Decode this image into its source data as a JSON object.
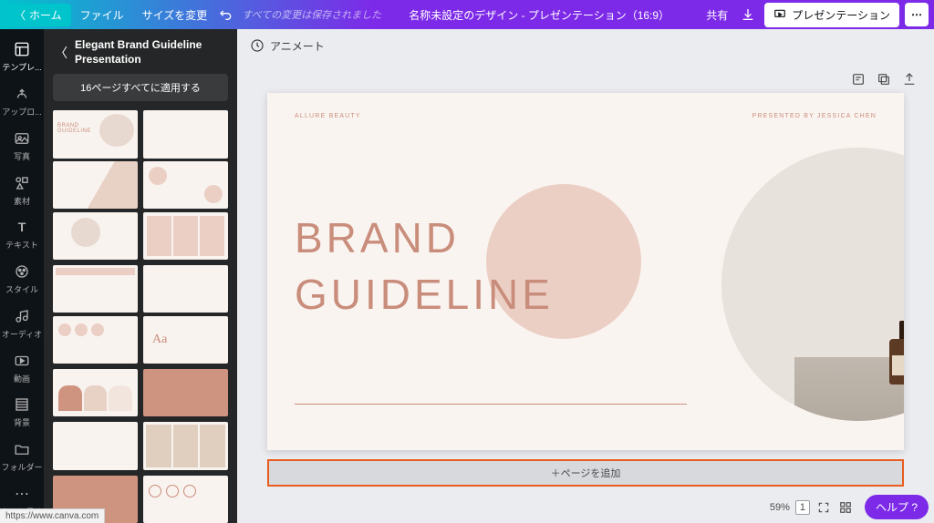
{
  "topbar": {
    "home": "ホーム",
    "file": "ファイル",
    "resize": "サイズを変更",
    "saved": "すべての変更は保存されました",
    "doc_title": "名称未設定のデザイン - プレゼンテーション（16:9）",
    "share": "共有",
    "present": "プレゼンテーション"
  },
  "rail": {
    "templates": "テンプレ...",
    "uploads": "アップロ...",
    "photos": "写真",
    "elements": "素材",
    "text": "テキスト",
    "styles": "スタイル",
    "audio": "オーディオ",
    "video": "動画",
    "background": "背景",
    "folders": "フォルダー",
    "more": "もっと見る"
  },
  "sidepanel": {
    "title": "Elegant Brand Guideline Presentation",
    "apply_all": "16ページすべてに適用する"
  },
  "context": {
    "animate": "アニメート"
  },
  "slide": {
    "brand": "ALLURE BEAUTY",
    "presenter": "PRESENTED BY JESSICA CHEN",
    "title_line1": "BRAND",
    "title_line2": "GUIDELINE"
  },
  "add_page": "＋ページを追加",
  "bottom": {
    "zoom": "59%",
    "page": "1",
    "help": "ヘルプ ?"
  },
  "status_url": "https://www.canva.com"
}
